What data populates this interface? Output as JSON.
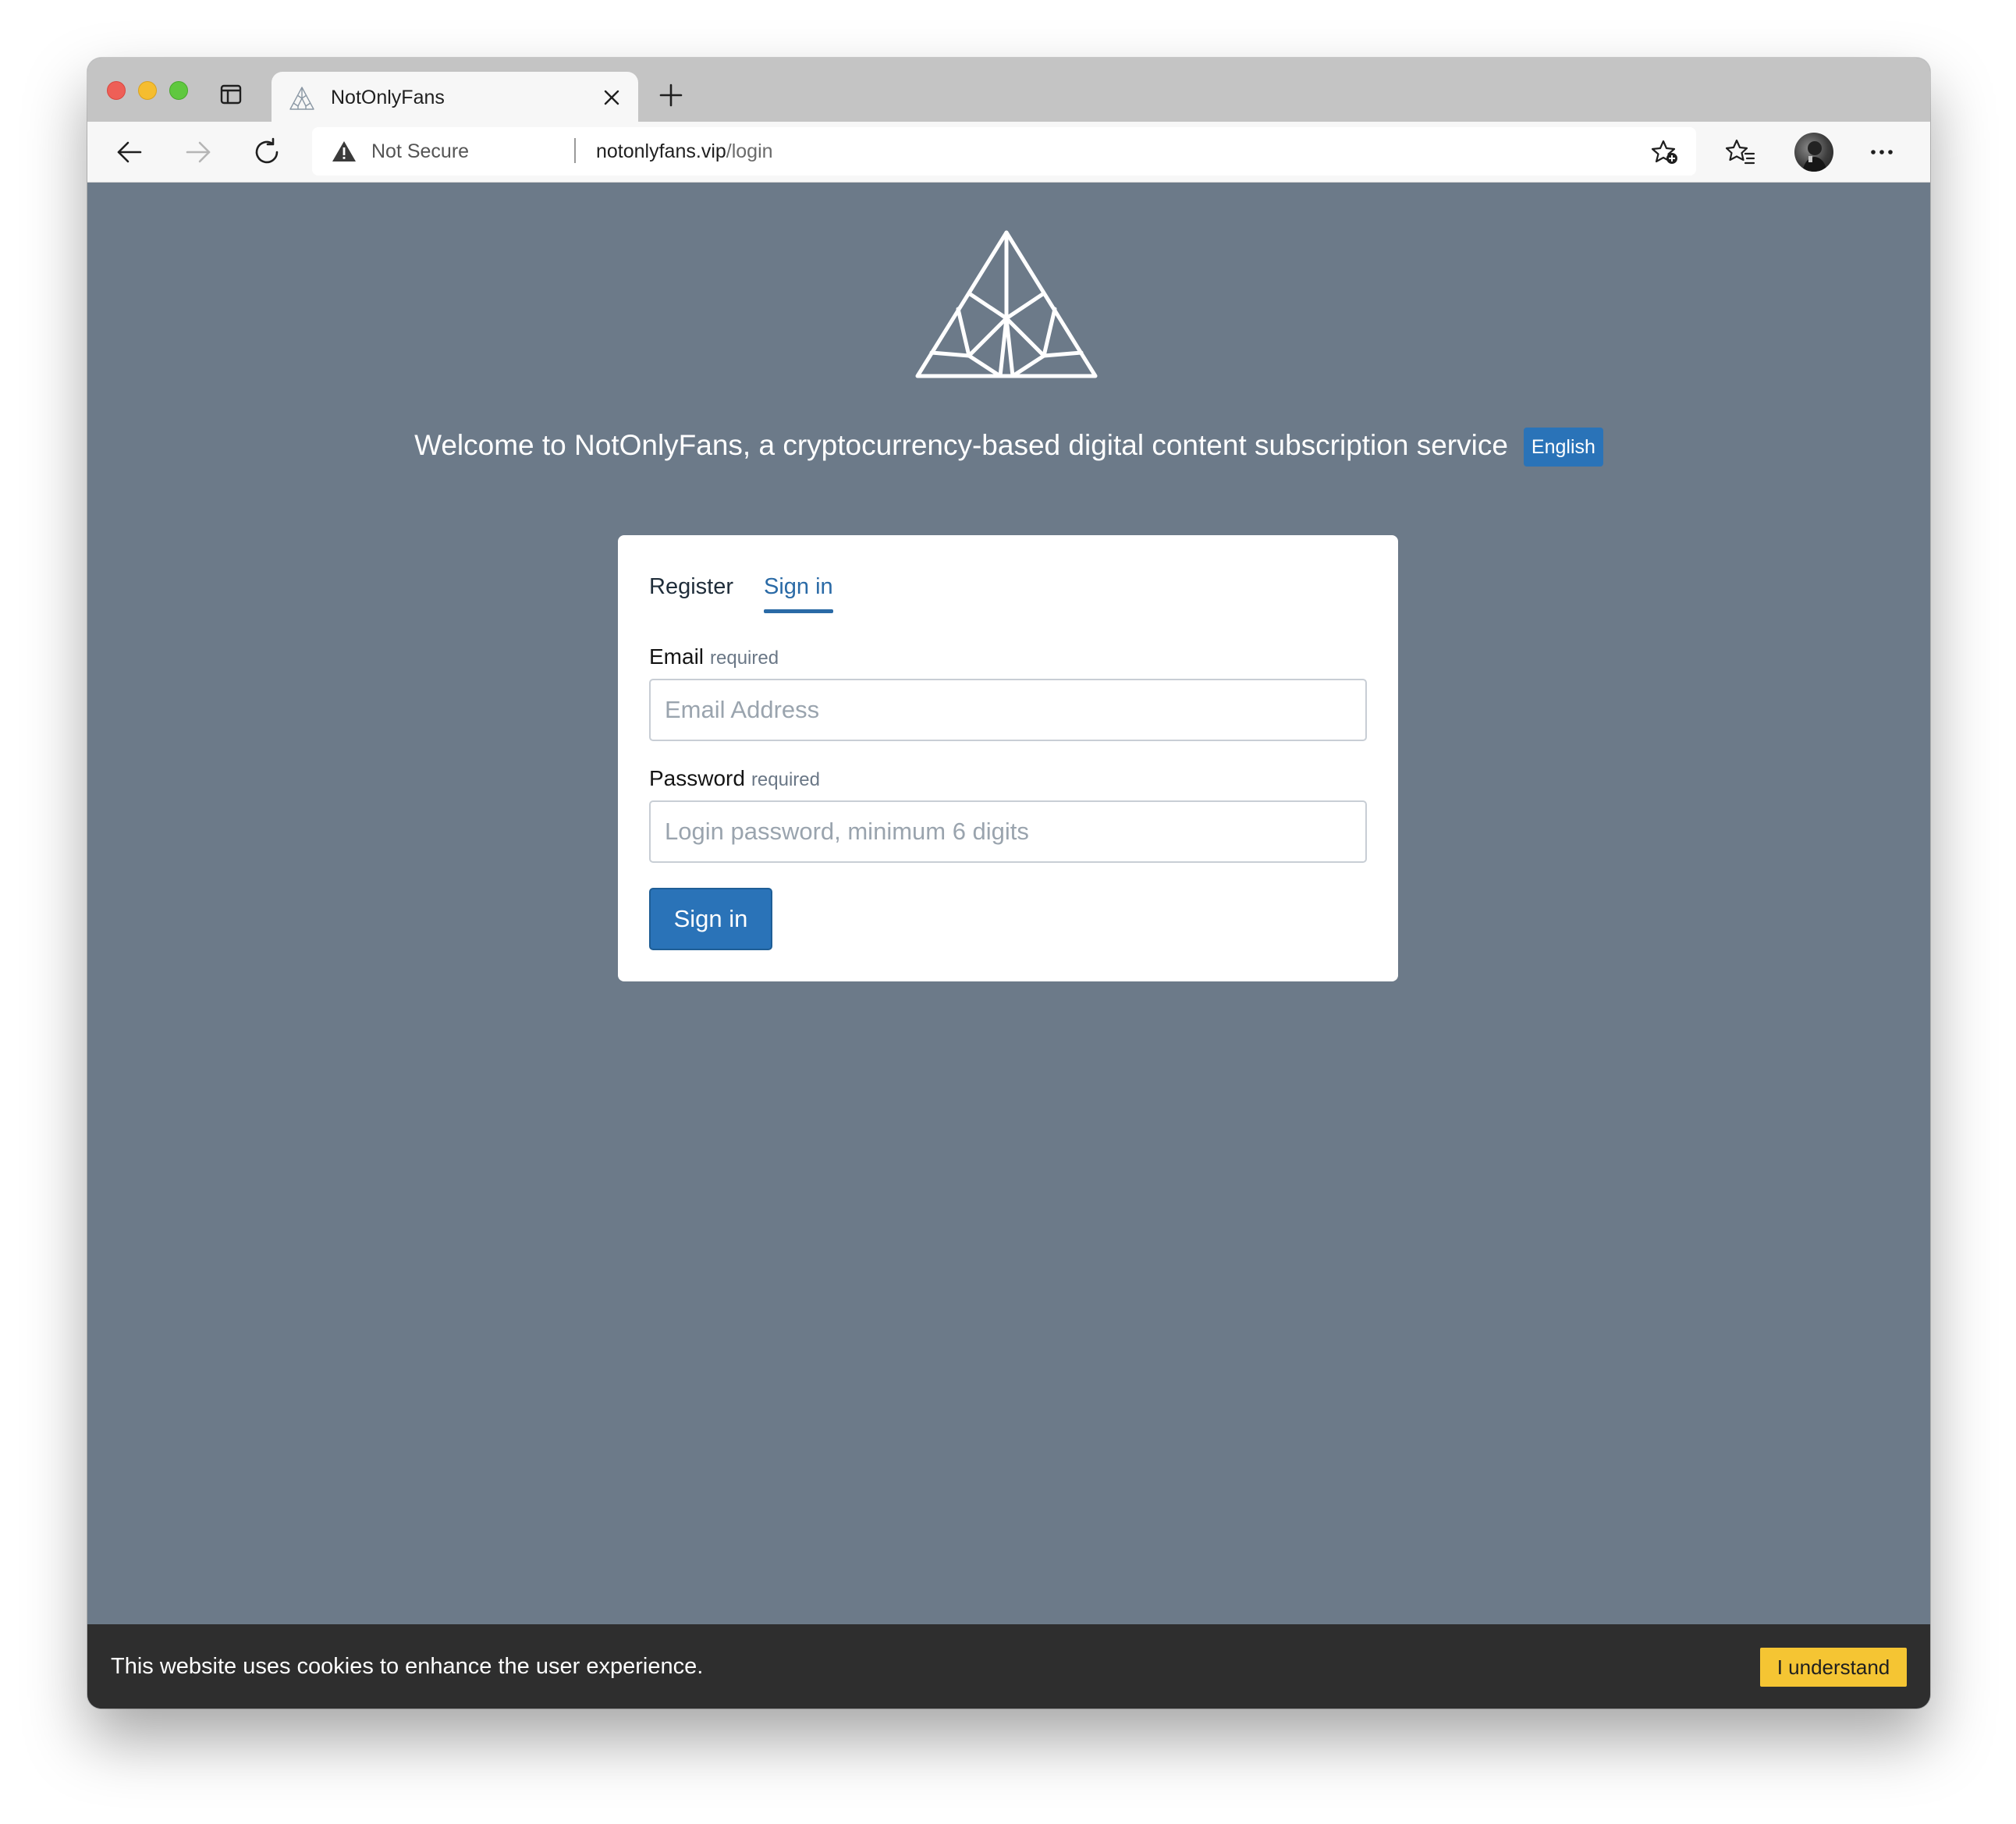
{
  "browser": {
    "tab": {
      "title": "NotOnlyFans"
    },
    "omnibox": {
      "security_label": "Not Secure",
      "url_host": "notonlyfans.vip",
      "url_path": "/login"
    }
  },
  "page": {
    "welcome": "Welcome to NotOnlyFans, a cryptocurrency-based digital content subscription service",
    "language": "English",
    "auth": {
      "tabs": {
        "register": "Register",
        "signin": "Sign in"
      },
      "email": {
        "label": "Email",
        "required": "required",
        "placeholder": "Email Address",
        "value": ""
      },
      "password": {
        "label": "Password",
        "required": "required",
        "placeholder": "Login password, minimum 6 digits",
        "value": ""
      },
      "submit": "Sign in"
    },
    "cookie": {
      "message": "This website uses cookies to enhance the user experience.",
      "accept": "I understand"
    }
  },
  "colors": {
    "page_background": "#6c7a89",
    "accent_blue": "#2a73b8",
    "active_tab": "#2a6aa6",
    "cookie_bar": "#2e2e2e",
    "cookie_button": "#f5c533"
  },
  "icons": {
    "tab_actions": "tab-actions-icon",
    "favicon": "pyramid-logo-icon",
    "tab_close": "close-icon",
    "new_tab": "plus-icon",
    "back": "arrow-left-icon",
    "forward": "arrow-right-icon",
    "reload": "reload-icon",
    "security": "warning-triangle-icon",
    "add_favorite": "star-plus-icon",
    "favorites": "favorites-list-icon",
    "profile": "profile-avatar",
    "more": "more-horizontal-icon",
    "logo": "pyramid-logo-icon"
  }
}
